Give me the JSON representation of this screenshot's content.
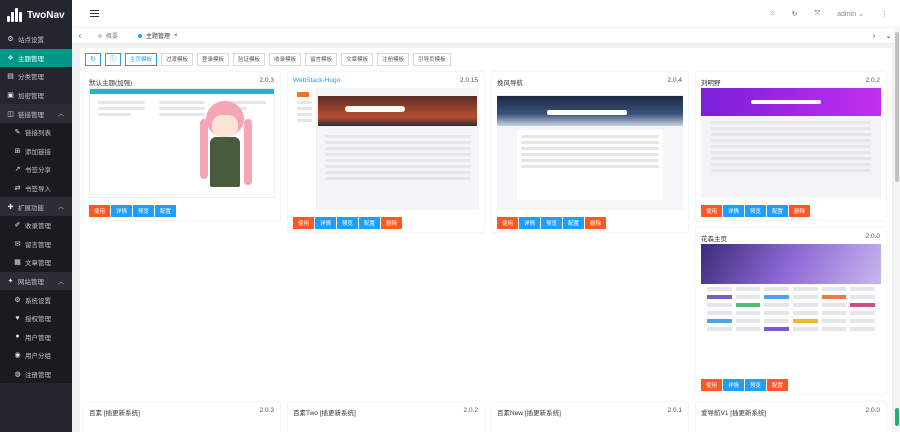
{
  "brand": {
    "name": "TwoNav"
  },
  "sidebar": {
    "items": [
      {
        "label": "站点设置",
        "icon": "gear-icon",
        "type": "item",
        "active": false
      },
      {
        "label": "主题管理",
        "icon": "palette-icon",
        "type": "item",
        "active": true
      },
      {
        "label": "分类管理",
        "icon": "folder-icon",
        "type": "item",
        "active": false
      },
      {
        "label": "加密管理",
        "icon": "lock-icon",
        "type": "item",
        "active": false
      },
      {
        "label": "链接管理",
        "icon": "link-icon",
        "type": "group",
        "active": false
      },
      {
        "label": "链接列表",
        "icon": "link-icon",
        "type": "sub",
        "active": false
      },
      {
        "label": "添加链接",
        "icon": "add-link-icon",
        "type": "sub",
        "active": false
      },
      {
        "label": "书签分享",
        "icon": "share-icon",
        "type": "sub",
        "active": false
      },
      {
        "label": "书签导入",
        "icon": "import-icon",
        "type": "sub",
        "active": false
      },
      {
        "label": "扩展功能",
        "icon": "puzzle-icon",
        "type": "group",
        "active": false
      },
      {
        "label": "收录管理",
        "icon": "pen-icon",
        "type": "sub",
        "active": false
      },
      {
        "label": "留言管理",
        "icon": "chat-icon",
        "type": "sub",
        "active": false
      },
      {
        "label": "文章管理",
        "icon": "article-icon",
        "type": "sub",
        "active": false
      },
      {
        "label": "网站管理",
        "icon": "globe-icon",
        "type": "group",
        "active": false
      },
      {
        "label": "系统设置",
        "icon": "settings-icon",
        "type": "sub",
        "active": false
      },
      {
        "label": "授权管理",
        "icon": "shield-icon",
        "type": "sub",
        "active": false
      },
      {
        "label": "用户管理",
        "icon": "user-icon",
        "type": "sub",
        "active": false
      },
      {
        "label": "用户分组",
        "icon": "users-icon",
        "type": "sub",
        "active": false
      },
      {
        "label": "注册管理",
        "icon": "register-icon",
        "type": "sub",
        "active": false
      }
    ]
  },
  "header": {
    "icons": [
      "home-icon",
      "refresh-icon",
      "fullscreen-icon"
    ],
    "user": "admin",
    "more": "⋮"
  },
  "tabs": [
    {
      "label": "概要",
      "active": false
    },
    {
      "label": "主题管理",
      "active": true
    }
  ],
  "toolbar": {
    "buttons": [
      "主页模板",
      "过渡模板",
      "登录模板",
      "验证模板",
      "收录模板",
      "留言模板",
      "文章模板",
      "注册模板",
      "引导页模板"
    ]
  },
  "cards": [
    {
      "name": "默认主题(加强)",
      "version": "2.0.3",
      "buttons": [
        "使用",
        "详情",
        "预览",
        "配置"
      ],
      "accent": "#21b5c8"
    },
    {
      "name": "WebStack-Hugo",
      "version": "2.0.15",
      "buttons": [
        "使用",
        "详情",
        "预览",
        "配置",
        "删除"
      ],
      "accent": "#f0722b"
    },
    {
      "name": "挽风导航",
      "version": "2.0.4",
      "buttons": [
        "使用",
        "详情",
        "预览",
        "配置",
        "删除"
      ],
      "accent": "#2b3b56"
    },
    {
      "name": "刘明野",
      "version": "2.0.2",
      "buttons": [
        "使用",
        "详情",
        "预览",
        "配置",
        "删除"
      ],
      "accent": "#9b27f0"
    },
    {
      "name": "花森主页",
      "version": "2.0.0",
      "buttons": [
        "使用",
        "详情",
        "预览",
        "配置"
      ],
      "accent": "#6f4fb5"
    },
    {
      "name": "百素 [插更新系统]",
      "version": "2.0.3"
    },
    {
      "name": "百素Two [插更新系统]",
      "version": "2.0.2"
    },
    {
      "name": "百素New [插更新系统]",
      "version": "2.0.1"
    },
    {
      "name": "爱导航V1 [插更新系统]",
      "version": "2.0.0"
    }
  ],
  "colors": {
    "sidebar_bg": "#23262e",
    "active": "#009688",
    "primary": "#1e9fff",
    "warn": "#ff5722"
  }
}
